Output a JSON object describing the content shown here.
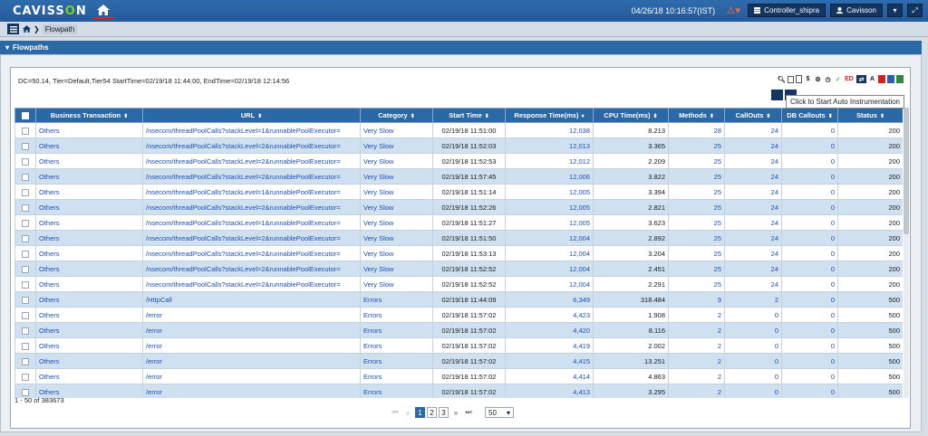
{
  "app": {
    "logo_text_a": "CAVISS",
    "logo_text_o": "O",
    "logo_text_b": "N"
  },
  "header": {
    "datetime": "04/26/18 10:16:57(IST)",
    "controller_label": "Controller_shipra",
    "user_label": "Cavisson"
  },
  "breadcrumb": {
    "current": "Flowpath"
  },
  "panel": {
    "title": "Flowpaths"
  },
  "filter": {
    "text": "DC=50.14, Tier=Default,Tier54 StartTime=02/19/18 11:44:00, EndTime=02/19/18 12:14:56"
  },
  "tooltip": {
    "text": "Click to Start Auto Instrumentation"
  },
  "table": {
    "columns": [
      "Business Transaction",
      "URL",
      "Category",
      "Start Time",
      "Response Time(ms)",
      "CPU Time(ms)",
      "Methods",
      "CallOuts",
      "DB Callouts",
      "Status"
    ],
    "rows": [
      [
        "Others",
        "/nsecom/threadPoolCalls?stackLevel=1&runnablePoolExecutor=",
        "Very Slow",
        "02/19/18 11:51:00",
        "12,038",
        "8.213",
        "28",
        "24",
        "0",
        "200"
      ],
      [
        "Others",
        "/nsecom/threadPoolCalls?stackLevel=2&runnablePoolExecutor=",
        "Very Slow",
        "02/19/18 11:52:03",
        "12,013",
        "3.365",
        "25",
        "24",
        "0",
        "200"
      ],
      [
        "Others",
        "/nsecom/threadPoolCalls?stackLevel=2&runnablePoolExecutor=",
        "Very Slow",
        "02/19/18 11:52:53",
        "12,012",
        "2.209",
        "25",
        "24",
        "0",
        "200"
      ],
      [
        "Others",
        "/nsecom/threadPoolCalls?stackLevel=2&runnablePoolExecutor=",
        "Very Slow",
        "02/19/18 11:57:45",
        "12,006",
        "3.822",
        "25",
        "24",
        "0",
        "200"
      ],
      [
        "Others",
        "/nsecom/threadPoolCalls?stackLevel=1&runnablePoolExecutor=",
        "Very Slow",
        "02/19/18 11:51:14",
        "12,005",
        "3.394",
        "25",
        "24",
        "0",
        "200"
      ],
      [
        "Others",
        "/nsecom/threadPoolCalls?stackLevel=2&runnablePoolExecutor=",
        "Very Slow",
        "02/19/18 11:52:26",
        "12,005",
        "2.821",
        "25",
        "24",
        "0",
        "200"
      ],
      [
        "Others",
        "/nsecom/threadPoolCalls?stackLevel=1&runnablePoolExecutor=",
        "Very Slow",
        "02/19/18 11:51:27",
        "12,005",
        "3.623",
        "25",
        "24",
        "0",
        "200"
      ],
      [
        "Others",
        "/nsecom/threadPoolCalls?stackLevel=2&runnablePoolExecutor=",
        "Very Slow",
        "02/19/18 11:51:50",
        "12,004",
        "2.892",
        "25",
        "24",
        "0",
        "200"
      ],
      [
        "Others",
        "/nsecom/threadPoolCalls?stackLevel=2&runnablePoolExecutor=",
        "Very Slow",
        "02/19/18 11:53:13",
        "12,004",
        "3.204",
        "25",
        "24",
        "0",
        "200"
      ],
      [
        "Others",
        "/nsecom/threadPoolCalls?stackLevel=2&runnablePoolExecutor=",
        "Very Slow",
        "02/19/18 11:52:52",
        "12,004",
        "2.451",
        "25",
        "24",
        "0",
        "200"
      ],
      [
        "Others",
        "/nsecom/threadPoolCalls?stackLevel=2&runnablePoolExecutor=",
        "Very Slow",
        "02/19/18 11:52:52",
        "12,004",
        "2.291",
        "25",
        "24",
        "0",
        "200"
      ],
      [
        "Others",
        "/HttpCall",
        "Errors",
        "02/19/18 11:44:09",
        "6,349",
        "318.484",
        "9",
        "2",
        "0",
        "500"
      ],
      [
        "Others",
        "/error",
        "Errors",
        "02/19/18 11:57:02",
        "4,423",
        "1.908",
        "2",
        "0",
        "0",
        "500"
      ],
      [
        "Others",
        "/error",
        "Errors",
        "02/19/18 11:57:02",
        "4,420",
        "8.116",
        "2",
        "0",
        "0",
        "500"
      ],
      [
        "Others",
        "/error",
        "Errors",
        "02/19/18 11:57:02",
        "4,419",
        "2.002",
        "2",
        "0",
        "0",
        "500"
      ],
      [
        "Others",
        "/error",
        "Errors",
        "02/19/18 11:57:02",
        "4,415",
        "13.251",
        "2",
        "0",
        "0",
        "500"
      ],
      [
        "Others",
        "/error",
        "Errors",
        "02/19/18 11:57:02",
        "4,414",
        "4.863",
        "2",
        "0",
        "0",
        "500"
      ],
      [
        "Others",
        "/error",
        "Errors",
        "02/19/18 11:57:02",
        "4,413",
        "3.295",
        "2",
        "0",
        "0",
        "500"
      ]
    ]
  },
  "footer": {
    "count_text": "1 - 50 of 383673",
    "pages": [
      "1",
      "2",
      "3"
    ],
    "page_size": "50"
  }
}
